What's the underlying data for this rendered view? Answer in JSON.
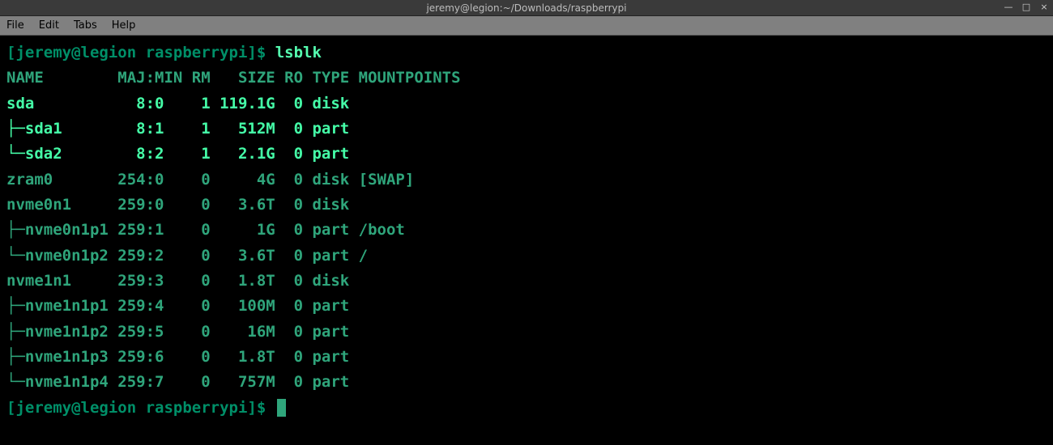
{
  "window": {
    "title": "jeremy@legion:~/Downloads/raspberrypi",
    "controls": {
      "min": "—",
      "max": "□",
      "close": "×"
    }
  },
  "menu": {
    "file": "File",
    "edit": "Edit",
    "tabs": "Tabs",
    "help": "Help"
  },
  "terminal": {
    "prompt": "[jeremy@legion raspberrypi]$ ",
    "command": "lsblk",
    "header": "NAME        MAJ:MIN RM   SIZE RO TYPE MOUNTPOINTS",
    "rows": [
      {
        "bright": true,
        "text": "sda           8:0    1 119.1G  0 disk "
      },
      {
        "bright": true,
        "text": "├─sda1        8:1    1   512M  0 part "
      },
      {
        "bright": true,
        "text": "└─sda2        8:2    1   2.1G  0 part "
      },
      {
        "bright": false,
        "text": "zram0       254:0    0     4G  0 disk [SWAP]"
      },
      {
        "bright": false,
        "text": "nvme0n1     259:0    0   3.6T  0 disk "
      },
      {
        "bright": false,
        "text": "├─nvme0n1p1 259:1    0     1G  0 part /boot"
      },
      {
        "bright": false,
        "text": "└─nvme0n1p2 259:2    0   3.6T  0 part /"
      },
      {
        "bright": false,
        "text": "nvme1n1     259:3    0   1.8T  0 disk "
      },
      {
        "bright": false,
        "text": "├─nvme1n1p1 259:4    0   100M  0 part "
      },
      {
        "bright": false,
        "text": "├─nvme1n1p2 259:5    0    16M  0 part "
      },
      {
        "bright": false,
        "text": "├─nvme1n1p3 259:6    0   1.8T  0 part "
      },
      {
        "bright": false,
        "text": "└─nvme1n1p4 259:7    0   757M  0 part "
      }
    ],
    "prompt2": "[jeremy@legion raspberrypi]$ "
  }
}
